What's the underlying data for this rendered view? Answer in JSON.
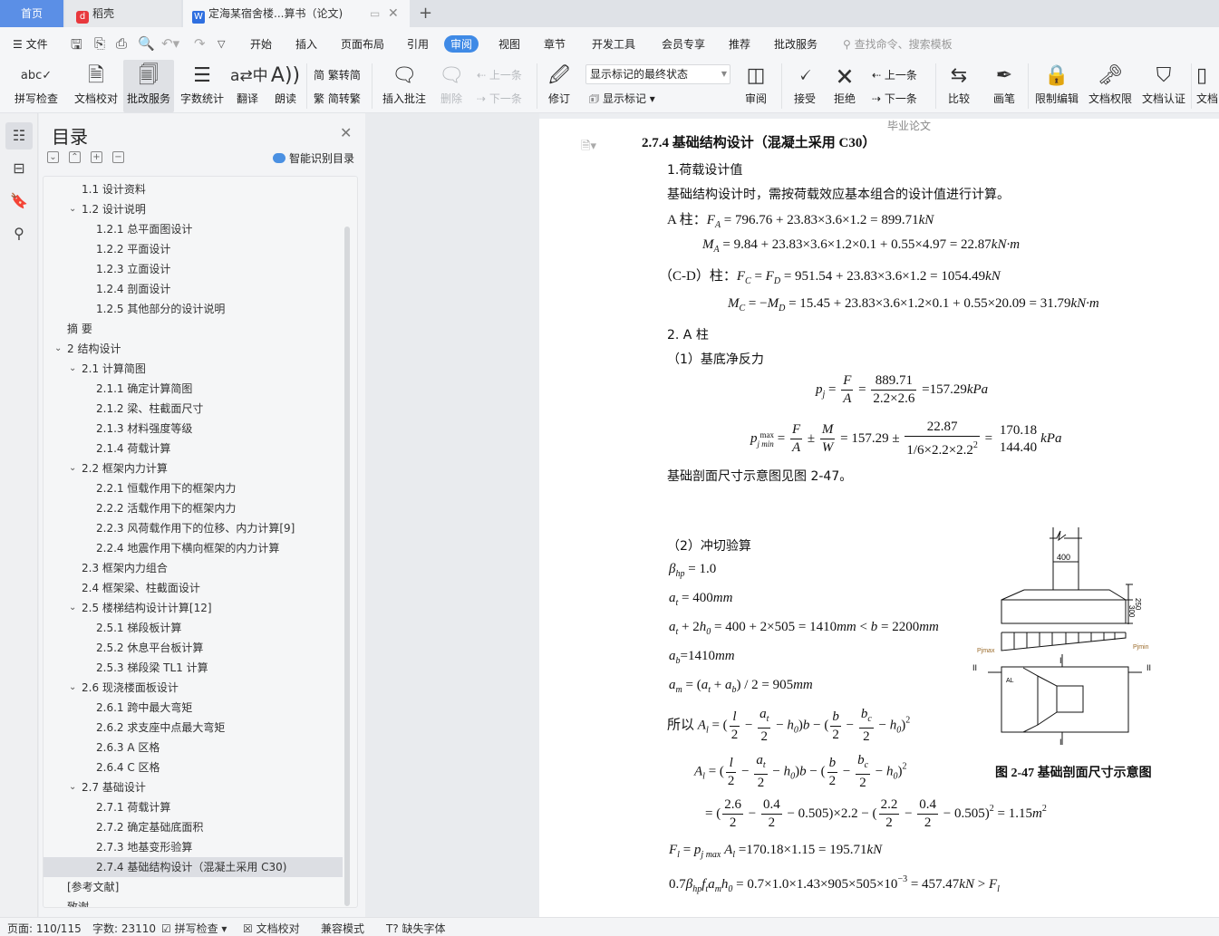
{
  "tabs": {
    "home": "首页",
    "daoke": "稻壳",
    "doc": "定海某宿舍楼...算书（论文)",
    "new_tab": "+"
  },
  "menu": {
    "file": "文件",
    "tabs": [
      "开始",
      "插入",
      "页面布局",
      "引用",
      "审阅",
      "视图",
      "章节",
      "开发工具",
      "会员专享",
      "推荐",
      "批改服务"
    ],
    "active": "审阅",
    "search_placeholder": "查找命令、搜索模板"
  },
  "ribbon": {
    "spell": "拼写检查",
    "proof": "文档校对",
    "correct": "批改服务",
    "count": "字数统计",
    "translate": "翻译",
    "read": "朗读",
    "t2s": "繁转简",
    "s2t": "简转繁",
    "insert_comment": "插入批注",
    "delete": "删除",
    "prev": "上一条",
    "next": "下一条",
    "revise": "修订",
    "markup_state": "显示标记的最终状态",
    "show_markup": "显示标记",
    "review": "审阅",
    "accept": "接受",
    "reject": "拒绝",
    "prev2": "上一条",
    "next2": "下一条",
    "compare": "比较",
    "pen": "画笔",
    "restrict": "限制编辑",
    "permission": "文档权限",
    "certify": "文档认证",
    "doc_more": "文档"
  },
  "toc": {
    "title": "目录",
    "smart": "智能识别目录",
    "items": [
      {
        "label": "1.1  设计资料",
        "level": 2,
        "chev": false
      },
      {
        "label": "1.2 设计说明",
        "level": 2,
        "chev": true
      },
      {
        "label": "1.2.1 总平面图设计",
        "level": 3
      },
      {
        "label": "1.2.2  平面设计",
        "level": 3
      },
      {
        "label": "1.2.3  立面设计",
        "level": 3
      },
      {
        "label": "1.2.4  剖面设计",
        "level": 3
      },
      {
        "label": "1.2.5  其他部分的设计说明",
        "level": 3
      },
      {
        "label": "摘    要",
        "level": 1,
        "chev": false
      },
      {
        "label": "2 结构设计",
        "level": 1,
        "chev": true
      },
      {
        "label": "2.1 计算简图",
        "level": 2,
        "chev": true
      },
      {
        "label": "2.1.1 确定计算简图",
        "level": 3
      },
      {
        "label": "2.1.2 梁、柱截面尺寸",
        "level": 3
      },
      {
        "label": "2.1.3 材料强度等级",
        "level": 3
      },
      {
        "label": "2.1.4 荷载计算",
        "level": 3
      },
      {
        "label": "2.2 框架内力计算",
        "level": 2,
        "chev": true
      },
      {
        "label": "2.2.1 恒载作用下的框架内力",
        "level": 3
      },
      {
        "label": "2.2.2 活载作用下的框架内力",
        "level": 3
      },
      {
        "label": "2.2.3 风荷载作用下的位移、内力计算[9]",
        "level": 3
      },
      {
        "label": "2.2.4 地震作用下横向框架的内力计算",
        "level": 3
      },
      {
        "label": "2.3 框架内力组合",
        "level": 2,
        "chev": false
      },
      {
        "label": "2.4 框架梁、柱截面设计",
        "level": 2,
        "chev": false
      },
      {
        "label": "2.5 楼梯结构设计计算[12]",
        "level": 2,
        "chev": true
      },
      {
        "label": "2.5.1 梯段板计算",
        "level": 3
      },
      {
        "label": "2.5.2 休息平台板计算",
        "level": 3
      },
      {
        "label": "2.5.3 梯段梁 TL1 计算",
        "level": 3
      },
      {
        "label": "2.6 现浇楼面板设计",
        "level": 2,
        "chev": true
      },
      {
        "label": "2.6.1 跨中最大弯矩",
        "level": 3
      },
      {
        "label": "2.6.2 求支座中点最大弯矩",
        "level": 3
      },
      {
        "label": "2.6.3 A 区格",
        "level": 3
      },
      {
        "label": "2.6.4 C 区格",
        "level": 3
      },
      {
        "label": "2.7 基础设计",
        "level": 2,
        "chev": true
      },
      {
        "label": "2.7.1 荷载计算",
        "level": 3
      },
      {
        "label": "2.7.2 确定基础底面积",
        "level": 3
      },
      {
        "label": "2.7.3 地基变形验算",
        "level": 3
      },
      {
        "label": "2.7.4 基础结构设计（混凝土采用 C30)",
        "level": 3,
        "selected": true
      },
      {
        "label": "[参考文献]",
        "level": 1,
        "chev": false
      },
      {
        "label": "致谢",
        "level": 1,
        "chev": false
      }
    ]
  },
  "doc": {
    "header": "毕业论文",
    "heading": "2.7.4 基础结构设计（混凝土采用 C30）",
    "p1": "1.荷载设计值",
    "p2": "基础结构设计时，需按荷载效应基本组合的设计值进行计算。",
    "p3": "2.  A 柱",
    "p4": "（1）基底净反力",
    "p5": "基础剖面尺寸示意图见图 2-47。",
    "p6": "（2）冲切验算",
    "caption": "图 2-47    基础剖面尺寸示意图",
    "formulas": {
      "FA": [
        "A 柱：",
        {
          "i": "F"
        },
        {
          "sub": "A"
        },
        " = 796.76 + 23.83×3.6×1.2 = 899.71",
        {
          "i": "kN"
        }
      ],
      "MA": [
        {
          "i": "M"
        },
        {
          "sub": "A"
        },
        " = 9.84 + 23.83×3.6×1.2×0.1 + 0.55×4.97 = 22.87",
        {
          "i": "kN·m"
        }
      ],
      "FC": [
        "（C-D）柱：",
        {
          "i": "F"
        },
        {
          "sub": "C"
        },
        " = ",
        {
          "i": "F"
        },
        {
          "sub": "D"
        },
        " = 951.54 + 23.83×3.6×1.2 = 1054.49",
        {
          "i": "kN"
        }
      ],
      "MC": [
        {
          "i": "M"
        },
        {
          "sub": "C"
        },
        " = −",
        {
          "i": "M"
        },
        {
          "sub": "D"
        },
        " = 15.45 + 23.83×3.6×1.2×0.1 + 0.55×20.09 = 31.79",
        {
          "i": "kN·m"
        }
      ],
      "pj": [
        {
          "i": "p"
        },
        {
          "sub": "j"
        },
        " = ",
        {
          "f": [
            [
              {
                "i": "F"
              }
            ],
            [
              {
                "i": "A"
              }
            ]
          ]
        },
        " = ",
        {
          "f": [
            "889.71",
            "2.2×2.6"
          ]
        },
        " =157.29",
        {
          "i": "kPa"
        }
      ],
      "pjm": [
        {
          "i": "p"
        },
        {
          "ss": [
            "max",
            "j min"
          ]
        },
        " = ",
        {
          "f": [
            [
              {
                "i": "F"
              }
            ],
            [
              {
                "i": "A"
              }
            ]
          ]
        },
        " ± ",
        {
          "f": [
            [
              {
                "i": "M"
              }
            ],
            [
              {
                "i": "W"
              }
            ]
          ]
        },
        " = 157.29 ± ",
        {
          "f": [
            "22.87",
            [
              "1/6×2.2×2.2",
              {
                "sup": "2"
              }
            ]
          ]
        },
        " = ",
        {
          "f": [
            "170.18",
            "144.40"
          ],
          "nobar": true
        },
        {
          "i": "kPa"
        }
      ],
      "beta": [
        {
          "i": "β"
        },
        {
          "sub": "hp"
        },
        " = 1.0"
      ],
      "at": [
        {
          "i": "a"
        },
        {
          "sub": "t"
        },
        " = 400",
        {
          "i": "mm"
        }
      ],
      "at2": [
        {
          "i": "a"
        },
        {
          "sub": "t"
        },
        " + 2",
        {
          "i": "h"
        },
        {
          "sub": "0"
        },
        " = 400 + 2×505 = 1410",
        {
          "i": "mm"
        },
        " < ",
        {
          "i": "b"
        },
        " = 2200",
        {
          "i": "mm"
        }
      ],
      "ab": [
        {
          "i": "a"
        },
        {
          "sub": "b"
        },
        "=1410",
        {
          "i": "mm"
        }
      ],
      "am": [
        {
          "i": "a"
        },
        {
          "sub": "m"
        },
        " = (",
        {
          "i": "a"
        },
        {
          "sub": "t"
        },
        " + ",
        {
          "i": "a"
        },
        {
          "sub": "b"
        },
        ") / 2 = 905",
        {
          "i": "mm"
        }
      ],
      "Al1": [
        "所以 ",
        {
          "i": "A"
        },
        {
          "sub": "l"
        },
        " = (",
        {
          "f": [
            [
              {
                "i": "l"
              }
            ],
            "2"
          ]
        },
        " − ",
        {
          "f": [
            [
              {
                "i": "a"
              },
              {
                "sub": "t"
              }
            ],
            "2"
          ]
        },
        " − ",
        {
          "i": "h"
        },
        {
          "sub": "0"
        },
        ")",
        {
          "i": "b"
        },
        " − (",
        {
          "f": [
            [
              {
                "i": "b"
              }
            ],
            "2"
          ]
        },
        " − ",
        {
          "f": [
            [
              {
                "i": "b"
              },
              {
                "sub": "c"
              }
            ],
            "2"
          ]
        },
        " − ",
        {
          "i": "h"
        },
        {
          "sub": "0"
        },
        ")",
        {
          "sup": "2"
        }
      ],
      "Al2": [
        {
          "i": "A"
        },
        {
          "sub": "l"
        },
        " = (",
        {
          "f": [
            [
              {
                "i": "l"
              }
            ],
            "2"
          ]
        },
        " − ",
        {
          "f": [
            [
              {
                "i": "a"
              },
              {
                "sub": "t"
              }
            ],
            "2"
          ]
        },
        " − ",
        {
          "i": "h"
        },
        {
          "sub": "0"
        },
        ")",
        {
          "i": "b"
        },
        " − (",
        {
          "f": [
            [
              {
                "i": "b"
              }
            ],
            "2"
          ]
        },
        " − ",
        {
          "f": [
            [
              {
                "i": "b"
              },
              {
                "sub": "c"
              }
            ],
            "2"
          ]
        },
        " − ",
        {
          "i": "h"
        },
        {
          "sub": "0"
        },
        ")",
        {
          "sup": "2"
        }
      ],
      "Al3": [
        "= (",
        {
          "f": [
            "2.6",
            "2"
          ]
        },
        " − ",
        {
          "f": [
            "0.4",
            "2"
          ]
        },
        " − 0.505)×2.2 − (",
        {
          "f": [
            "2.2",
            "2"
          ]
        },
        " − ",
        {
          "f": [
            "0.4",
            "2"
          ]
        },
        " − 0.505)",
        {
          "sup": "2"
        },
        " = 1.15",
        {
          "i": "m"
        },
        {
          "sup": "2"
        }
      ],
      "Fl": [
        {
          "i": "F"
        },
        {
          "sub": "l"
        },
        " = ",
        {
          "i": "p"
        },
        {
          "sub": "j max"
        },
        " ",
        {
          "i": "A"
        },
        {
          "sub": "l"
        },
        " =170.18×1.15 = 195.71",
        {
          "i": "kN"
        }
      ],
      "check": [
        "0.7",
        {
          "i": "β"
        },
        {
          "sub": "hp"
        },
        {
          "i": "f"
        },
        {
          "sub": "t"
        },
        {
          "i": "a"
        },
        {
          "sub": "m"
        },
        {
          "i": "h"
        },
        {
          "sub": "0"
        },
        " = 0.7×1.0×1.43×905×505×10",
        {
          "sup": "−3"
        },
        " = 457.47",
        {
          "i": "kN"
        },
        " > ",
        {
          "i": "F"
        },
        {
          "sub": "l"
        }
      ]
    },
    "figure": {
      "dim_400": "400",
      "dim_250": "250",
      "dim_300": "300",
      "pjmax": "Pjmax",
      "pjmin": "Pjmin",
      "sec_I": "I",
      "sec_II": "II",
      "area": "AL"
    }
  },
  "status": {
    "page": "页面: 110/115",
    "words": "字数: 23110",
    "spell": "拼写检查",
    "proof": "文档校对",
    "compat": "兼容模式",
    "missing_font": "缺失字体"
  },
  "colors": {
    "accent": "#3f8ae6",
    "home_tab": "#5b8fe6",
    "daoke_logo": "#e8383d"
  }
}
